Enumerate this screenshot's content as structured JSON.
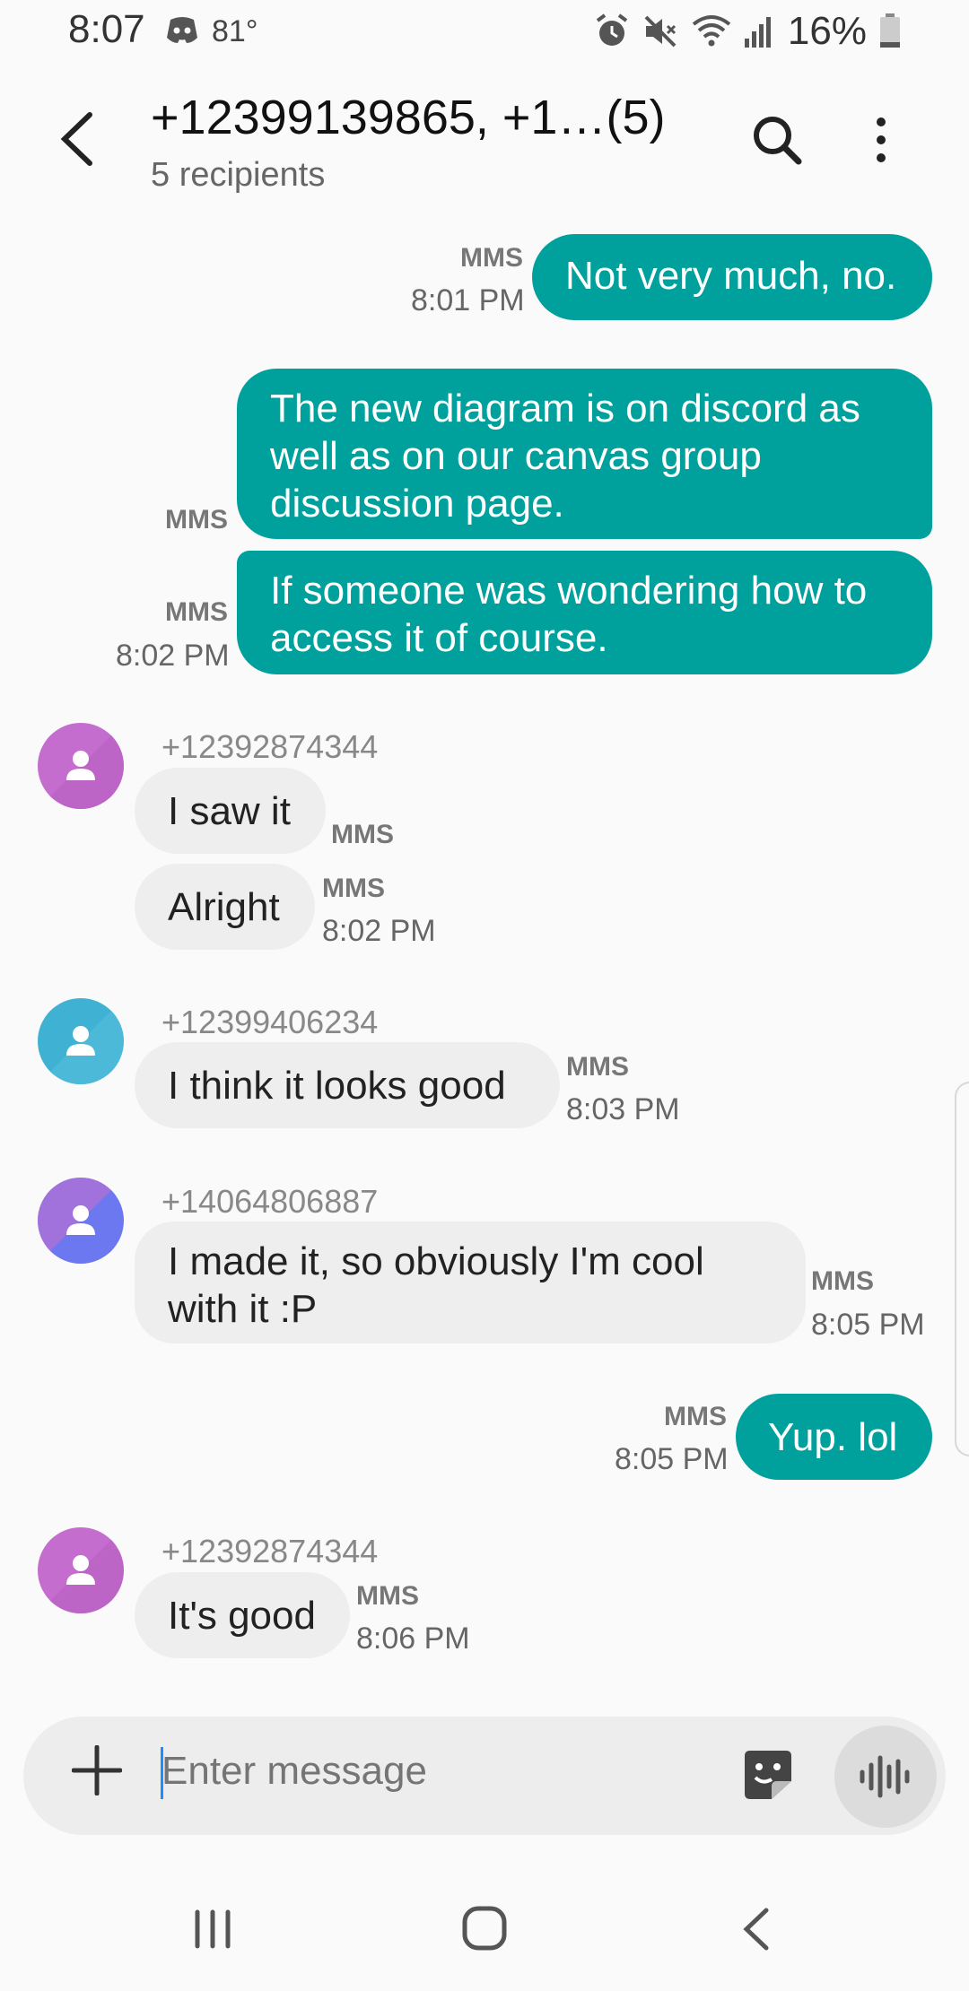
{
  "status_bar": {
    "time": "8:07",
    "temperature": "81°",
    "battery": "16%",
    "icons": [
      "discord-icon",
      "alarm-icon",
      "mute-icon",
      "wifi-icon",
      "signal-icon",
      "battery-icon"
    ]
  },
  "header": {
    "title": "+12399139865, +1…(5)",
    "subtitle": "5 recipients"
  },
  "messages": [
    {
      "direction": "out",
      "text": "Not very much, no.",
      "type": "MMS",
      "time": "8:01 PM"
    },
    {
      "direction": "out",
      "text": "The new diagram is on discord as well as on our canvas group discussion page.",
      "type": "MMS"
    },
    {
      "direction": "out",
      "text": "If someone was wondering how to access it of course.",
      "type": "MMS",
      "time": "8:02 PM"
    },
    {
      "direction": "in",
      "sender": "+12392874344",
      "text": "I saw it",
      "type": "MMS"
    },
    {
      "direction": "in",
      "text": "Alright",
      "type": "MMS",
      "time": "8:02 PM"
    },
    {
      "direction": "in",
      "sender": "+12399406234",
      "text": "I think it looks good",
      "type": "MMS",
      "time": "8:03 PM"
    },
    {
      "direction": "in",
      "sender": "+14064806887",
      "text": "I made it, so obviously I'm cool with it :P",
      "type": "MMS",
      "time": "8:05 PM"
    },
    {
      "direction": "out",
      "text": "Yup. lol",
      "type": "MMS",
      "time": "8:05 PM"
    },
    {
      "direction": "in",
      "sender": "+12392874344",
      "text": "It's good",
      "type": "MMS",
      "time": "8:06 PM"
    }
  ],
  "composer": {
    "placeholder": "Enter message"
  },
  "colors": {
    "outgoing_bubble": "#00a19c",
    "incoming_bubble": "#eeeeee",
    "avatar_purple": "#c56dcf",
    "avatar_teal": "#3fb2d3",
    "avatar_blue": "#6b78f0"
  }
}
